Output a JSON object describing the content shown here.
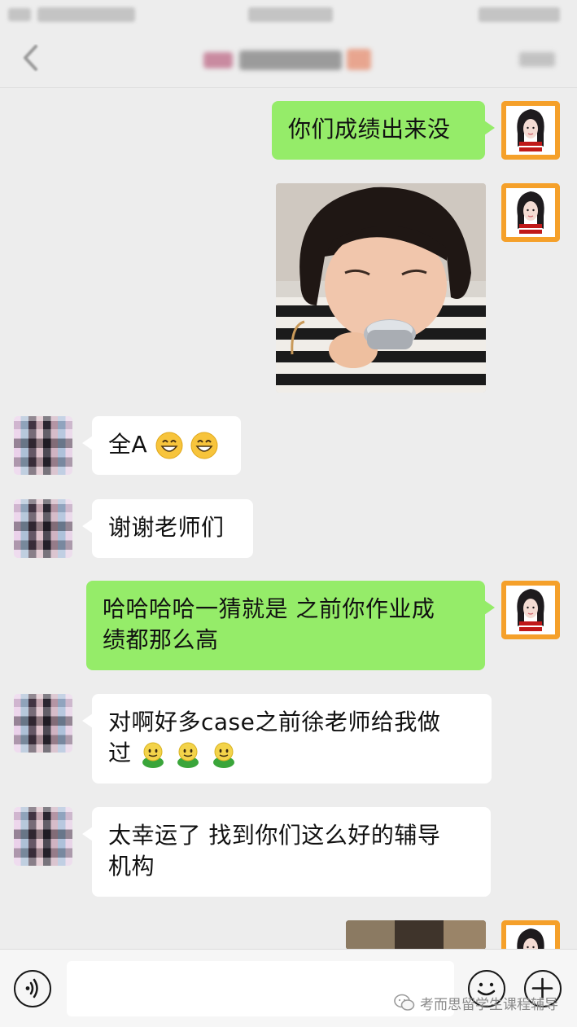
{
  "messages": [
    {
      "id": "m1",
      "from": "me",
      "type": "text",
      "text": "你们成绩出来没"
    },
    {
      "id": "m2",
      "from": "me",
      "type": "image",
      "icon": "child-drinking-photo"
    },
    {
      "id": "m3",
      "from": "other",
      "type": "text",
      "text": "全A",
      "emoji": [
        "grinning-emoji",
        "grinning-emoji"
      ]
    },
    {
      "id": "m4",
      "from": "other",
      "type": "text",
      "text": "谢谢老师们"
    },
    {
      "id": "m5",
      "from": "me",
      "type": "text",
      "line1": "哈哈哈哈一猜就是 之前你作业成",
      "line2": "绩都那么高"
    },
    {
      "id": "m6",
      "from": "other",
      "type": "text",
      "line1": "对啊好多case之前徐老师给我做",
      "line2": "过",
      "emoji": [
        "happy-green-emoji",
        "happy-green-emoji",
        "happy-green-emoji"
      ]
    },
    {
      "id": "m7",
      "from": "other",
      "type": "text",
      "line1": "太幸运了 找到你们这么好的辅导",
      "line2": "机构"
    },
    {
      "id": "m8",
      "from": "me",
      "type": "image",
      "icon": "photo-thumbnail"
    }
  ],
  "input_bar": {
    "placeholder": "",
    "value": ""
  },
  "watermark": {
    "text": "考而思留学生课程辅导"
  },
  "colors": {
    "sent_bubble": "#95ec69",
    "recv_bubble": "#ffffff",
    "background": "#ededed",
    "avatar_orange": "#f5a02a"
  }
}
